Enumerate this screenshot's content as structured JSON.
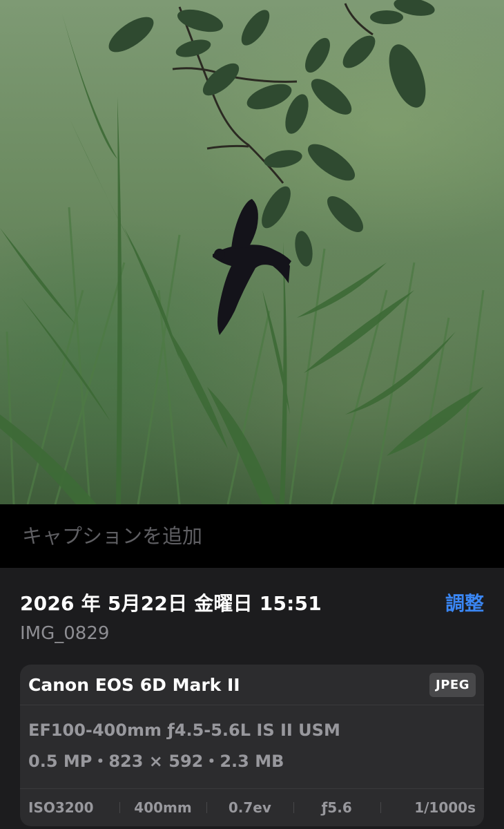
{
  "photo": {
    "subject": "bird-in-flight-over-grass"
  },
  "caption": {
    "placeholder": "キャプションを追加"
  },
  "info": {
    "datetime": "2026 年 5月22日 金曜日 15:51",
    "adjust_label": "調整",
    "filename": "IMG_0829"
  },
  "camera_card": {
    "camera": "Canon EOS 6D Mark II",
    "format_badge": "JPEG",
    "lens": "EF100-400mm ƒ4.5-5.6L IS II USM",
    "specs": "0.5 MP・823 × 592・2.3 MB",
    "exif": {
      "iso": "ISO3200",
      "focal_length": "400mm",
      "exposure": "0.7ev",
      "aperture": "ƒ5.6",
      "shutter": "1/1000s"
    }
  },
  "colors": {
    "background": "#000000",
    "panel": "#1c1c1e",
    "card": "#2c2c2e",
    "accent": "#3a86f3",
    "secondary_text": "#8e8e93"
  }
}
